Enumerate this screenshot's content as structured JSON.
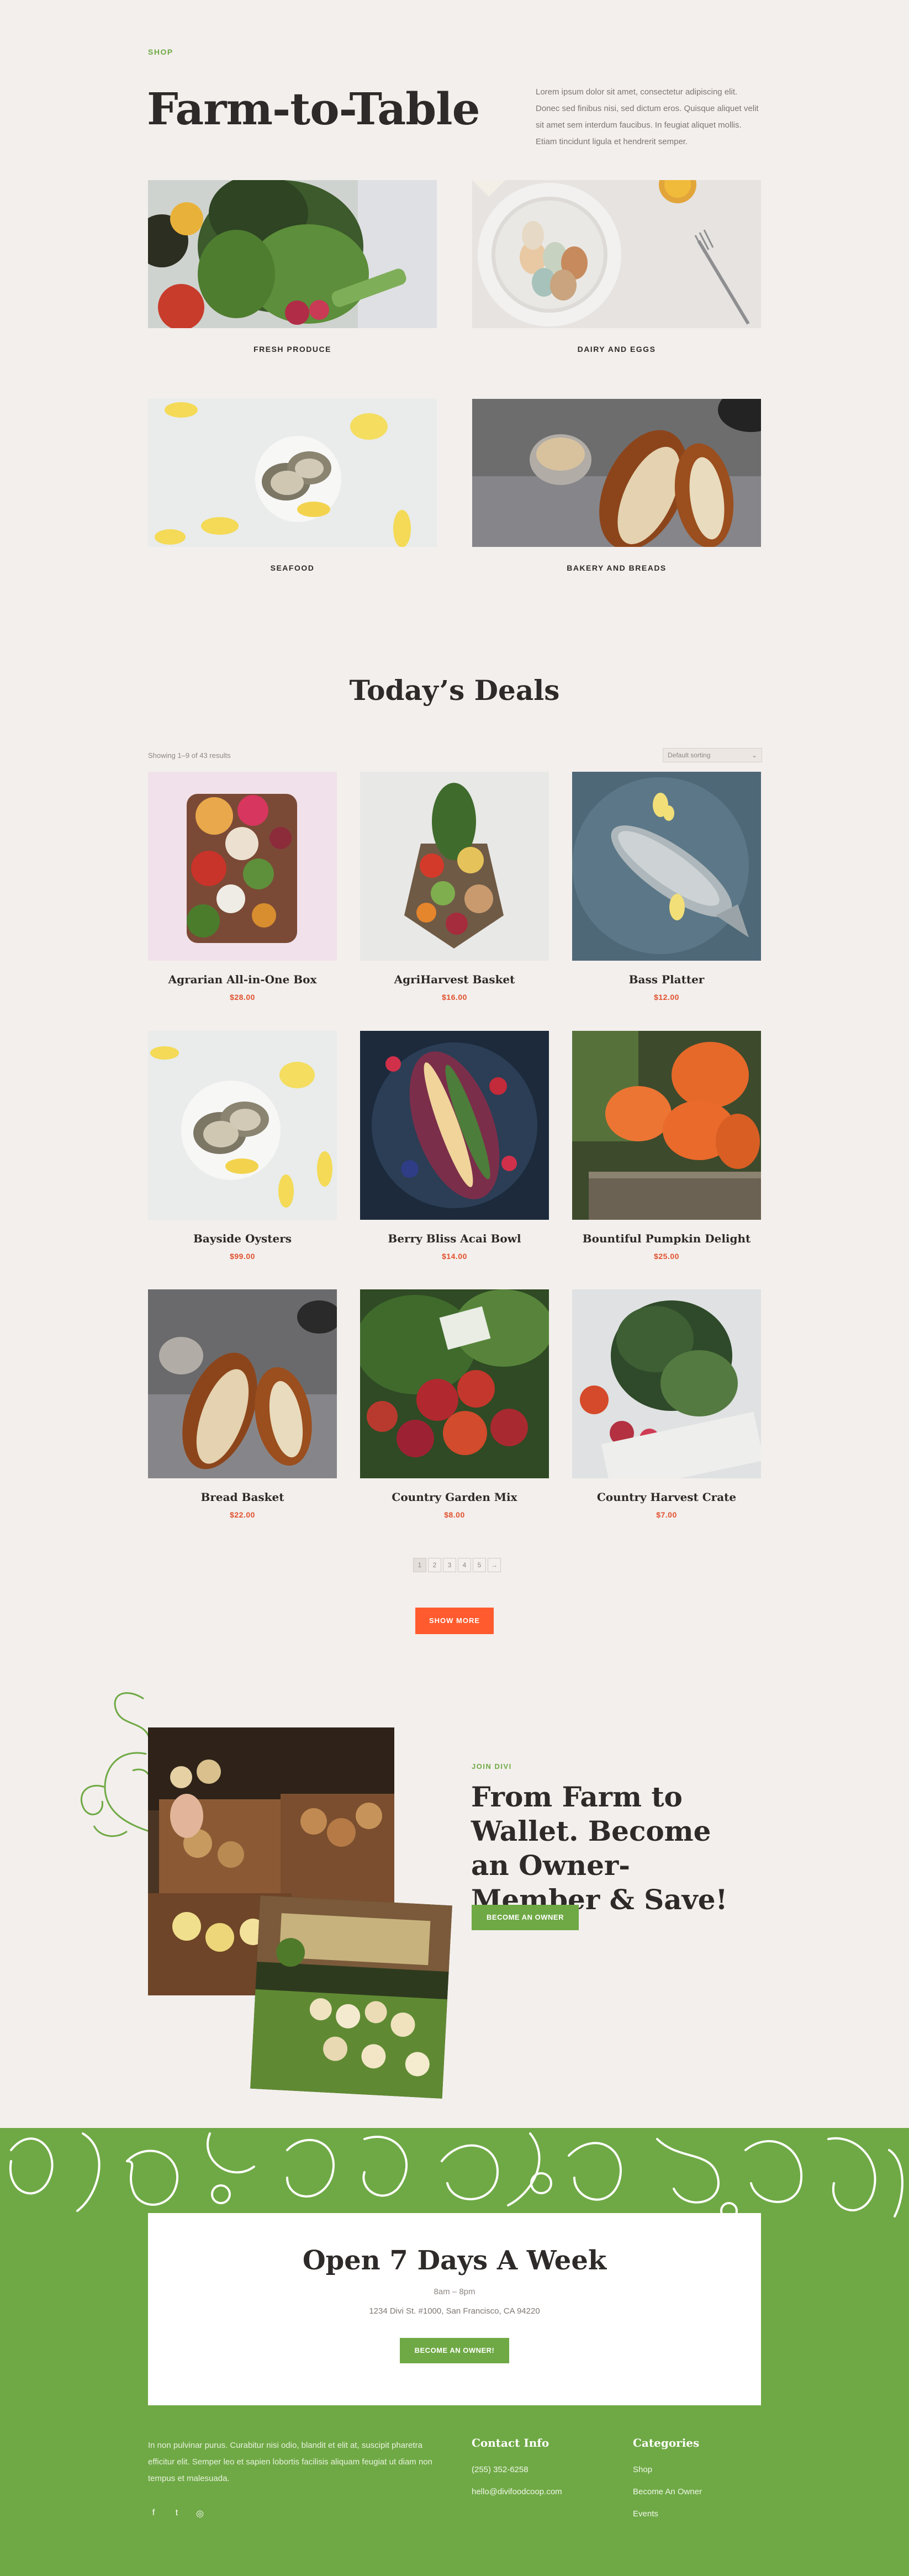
{
  "shop": {
    "eyebrow": "SHOP",
    "title": "Farm-to-Table",
    "intro": "Lorem ipsum dolor sit amet, consectetur adipiscing elit. Donec sed finibus nisi, sed dictum eros. Quisque aliquet velit sit amet sem interdum faucibus. In feugiat aliquet mollis. Etiam tincidunt ligula et hendrerit semper."
  },
  "categories": [
    {
      "label": "FRESH PRODUCE"
    },
    {
      "label": "DAIRY AND EGGS"
    },
    {
      "label": "SEAFOOD"
    },
    {
      "label": "BAKERY AND BREADS"
    }
  ],
  "deals": {
    "title": "Today’s Deals",
    "result_count": "Showing 1–9 of 43 results",
    "sort_value": "Default sorting",
    "products": [
      {
        "name": "Agrarian All-in-One Box",
        "price": "$28.00"
      },
      {
        "name": "AgriHarvest Basket",
        "price": "$16.00"
      },
      {
        "name": "Bass Platter",
        "price": "$12.00"
      },
      {
        "name": "Bayside Oysters",
        "price": "$99.00"
      },
      {
        "name": "Berry Bliss Acai Bowl",
        "price": "$14.00"
      },
      {
        "name": "Bountiful Pumpkin Delight",
        "price": "$25.00"
      },
      {
        "name": "Bread Basket",
        "price": "$22.00"
      },
      {
        "name": "Country Garden Mix",
        "price": "$8.00"
      },
      {
        "name": "Country Harvest Crate",
        "price": "$7.00"
      }
    ],
    "pages": [
      "1",
      "2",
      "3",
      "4",
      "5",
      "→"
    ],
    "show_more": "SHOW MORE"
  },
  "join": {
    "eyebrow": "JOIN DIVI",
    "title": "From Farm to Wallet. Become an Owner-Member & Save!",
    "button": "BECOME AN OWNER"
  },
  "open": {
    "title": "Open 7 Days A Week",
    "hours": "8am – 8pm",
    "address": "1234 Divi St. #1000, San Francisco, CA 94220",
    "button": "BECOME AN OWNER!"
  },
  "footer": {
    "text": "In non pulvinar purus. Curabitur nisi odio, blandit et elit at, suscipit pharetra efficitur elit. Semper leo et sapien lobortis facilisis aliquam feugiat ut diam non tempus et malesuada.",
    "social": [
      "f",
      "t",
      "◎"
    ],
    "contact_heading": "Contact Info",
    "phone": "(255) 352-6258",
    "email": "hello@divifoodcoop.com",
    "categories_heading": "Categories",
    "links": [
      "Shop",
      "Become An Owner",
      "Events"
    ]
  },
  "colors": {
    "accent_green": "#6fa945",
    "accent_orange": "#ff5b2e",
    "price_red": "#e0512f",
    "background": "#f3efec"
  }
}
